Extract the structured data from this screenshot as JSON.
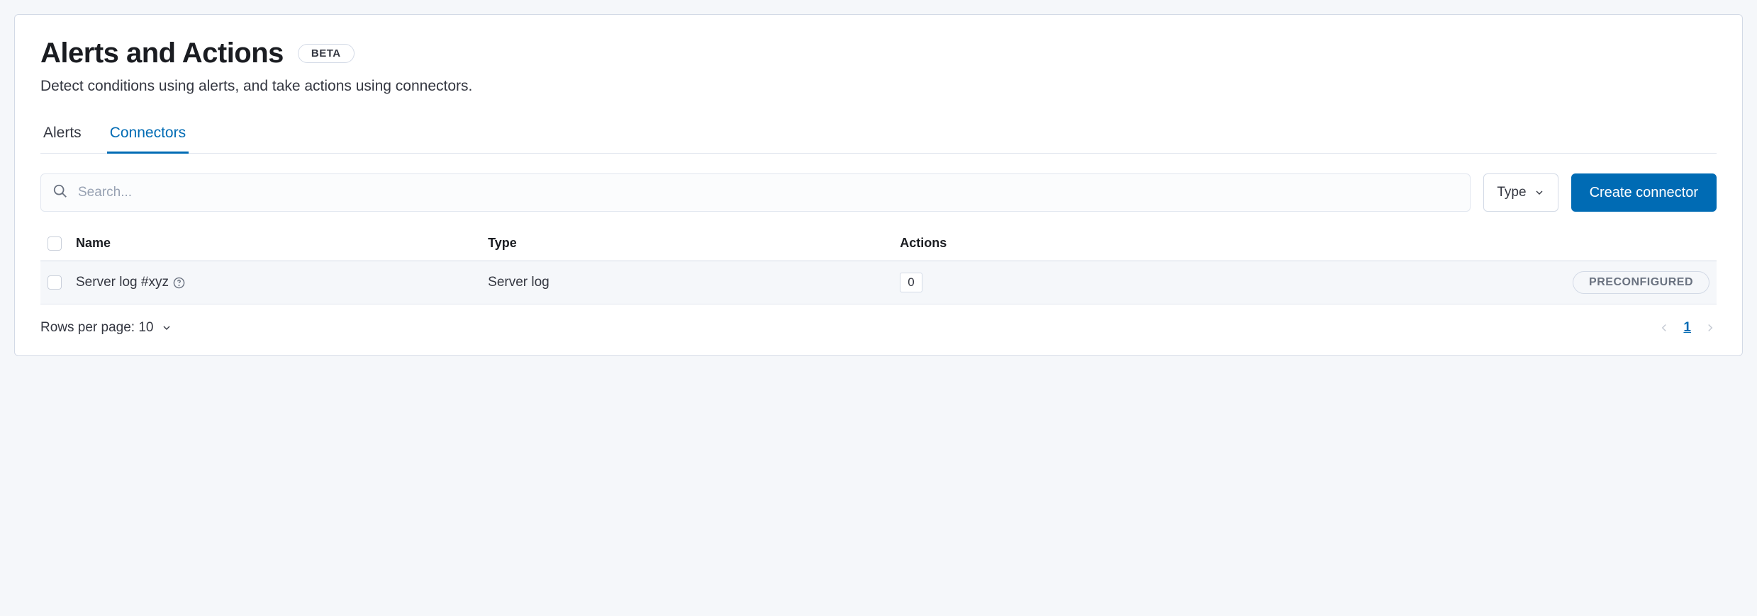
{
  "header": {
    "title": "Alerts and Actions",
    "badge": "BETA",
    "subtitle": "Detect conditions using alerts, and take actions using connectors."
  },
  "tabs": {
    "alerts": "Alerts",
    "connectors": "Connectors",
    "active": "connectors"
  },
  "controls": {
    "search_placeholder": "Search...",
    "type_filter_label": "Type",
    "create_button": "Create connector"
  },
  "table": {
    "columns": {
      "name": "Name",
      "type": "Type",
      "actions": "Actions"
    },
    "rows": [
      {
        "name": "Server log #xyz",
        "type": "Server log",
        "actions_count": "0",
        "badge": "PRECONFIGURED"
      }
    ]
  },
  "pagination": {
    "rows_per_page_label": "Rows per page: 10",
    "current_page": "1"
  }
}
